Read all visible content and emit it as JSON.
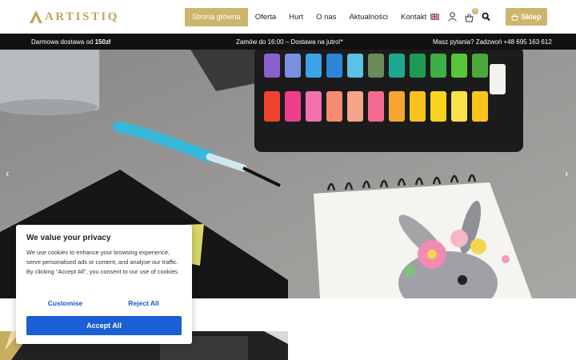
{
  "brand": {
    "name": "ARTISTIQ"
  },
  "nav": {
    "items": [
      {
        "label": "Strona główna",
        "active": true
      },
      {
        "label": "Oferta"
      },
      {
        "label": "Hurt"
      },
      {
        "label": "O nas"
      },
      {
        "label": "Aktualności"
      },
      {
        "label": "Kontakt"
      }
    ]
  },
  "tools": {
    "cart_count": "0",
    "shop_label": "Sklep",
    "language_flag": "uk-flag-icon"
  },
  "infobar": {
    "left_prefix": "Darmowa dostawa od ",
    "left_bold": "150zł",
    "center": "Zamów do 16:00 – Dostawa na jutro!*",
    "right": "Masz pytania? Zadzwoń +48 695 163 612"
  },
  "hero": {
    "prev_icon": "chevron-left-icon",
    "next_icon": "chevron-right-icon",
    "prev_glyph": "‹",
    "next_glyph": "›"
  },
  "cookie": {
    "title": "We value your privacy",
    "text": "We use cookies to enhance your browsing experience, serve personalised ads or content, and analyse our traffic. By clicking \"Accept All\", you consent to our use of cookies.",
    "customise": "Customise",
    "reject": "Reject All",
    "accept": "Accept All"
  },
  "colors": {
    "gold": "#cdb56c",
    "accent_blue": "#1a5fd4",
    "bar": "#111111"
  }
}
